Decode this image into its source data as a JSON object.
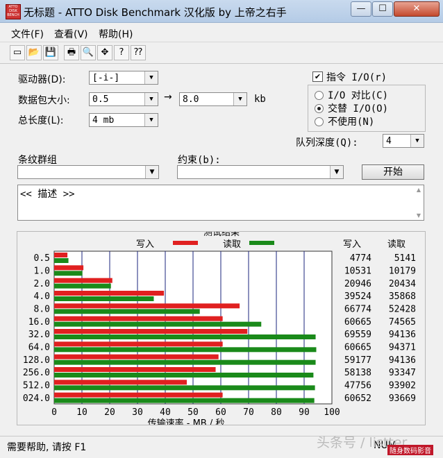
{
  "window": {
    "title": "无标题 - ATTO Disk Benchmark  汉化版 by 上帝之右手",
    "icon_text": "ATTO DISK BENCH",
    "min_glyph": "—",
    "max_glyph": "☐",
    "close_glyph": "✕"
  },
  "menu": [
    "文件(F)",
    "查看(V)",
    "帮助(H)"
  ],
  "toolbar_icons": [
    {
      "name": "new-icon",
      "glyph": "▭"
    },
    {
      "name": "open-icon",
      "glyph": "📂"
    },
    {
      "name": "save-icon",
      "glyph": "💾"
    },
    {
      "name": "print-icon",
      "glyph": "🖶"
    },
    {
      "name": "print-preview-icon",
      "glyph": "🔍"
    },
    {
      "name": "move-icon",
      "glyph": "✥"
    },
    {
      "name": "help-icon",
      "glyph": "?"
    },
    {
      "name": "context-help-icon",
      "glyph": "⁇"
    }
  ],
  "settings": {
    "drive_label": "驱动器(D):",
    "drive_value": "[-i-]",
    "transfer_label": "数据包大小:",
    "transfer_from": "0.5",
    "transfer_to": "8.0",
    "transfer_unit": "kb",
    "arrow": "→",
    "length_label": "总长度(L):",
    "length_value": "4 mb",
    "io_label": "指令 I/O(r)",
    "io_checked": true,
    "mode_options": [
      "I/O 对比(C)",
      "交替 I/O(O)",
      "不使用(N)"
    ],
    "mode_selected": 1,
    "queue_label": "队列深度(Q):",
    "queue_value": "4",
    "stripe_label": "条纹群组",
    "stripe_value": "",
    "constraint_label": "约束(b):",
    "constraint_value": "",
    "start_label": "开始",
    "description": "<< 描述 >>"
  },
  "results": {
    "group_title": "测试结果",
    "legend_write": "写入",
    "legend_read": "读取",
    "col_write": "写入",
    "col_read": "读取",
    "sizes": [
      "0.5",
      "1.0",
      "2.0",
      "4.0",
      "8.0",
      "16.0",
      "32.0",
      "64.0",
      "128.0",
      "256.0",
      "512.0",
      "024.0"
    ],
    "write_values": [
      "4774",
      "10531",
      "20946",
      "39524",
      "66774",
      "60665",
      "69559",
      "60665",
      "59177",
      "58138",
      "47756",
      "60652"
    ],
    "read_values": [
      "5141",
      "10179",
      "20434",
      "35868",
      "52428",
      "74565",
      "94136",
      "94371",
      "94136",
      "93347",
      "93902",
      "93669"
    ],
    "colors": {
      "write": "#e02020",
      "read": "#1a8a1a",
      "grid": "#1a237e"
    }
  },
  "chart_data": {
    "type": "bar",
    "categories": [
      "0.5",
      "1.0",
      "2.0",
      "4.0",
      "8.0",
      "16.0",
      "32.0",
      "64.0",
      "128.0",
      "256.0",
      "512.0",
      "024.0"
    ],
    "series": [
      {
        "name": "写入",
        "values": [
          4.774,
          10.531,
          20.946,
          39.524,
          66.774,
          60.665,
          69.559,
          60.665,
          59.177,
          58.138,
          47.756,
          60.652
        ]
      },
      {
        "name": "读取",
        "values": [
          5.141,
          10.179,
          20.434,
          35.868,
          52.428,
          74.565,
          94.136,
          94.371,
          94.136,
          93.347,
          93.902,
          93.669
        ]
      }
    ],
    "title": "测试结果",
    "xlabel": "传输速率 - MB / 秒",
    "ylabel": "",
    "xlim": [
      0,
      100
    ],
    "xticks": [
      "0",
      "10",
      "20",
      "30",
      "40",
      "50",
      "60",
      "70",
      "80",
      "90",
      "100"
    ],
    "orientation": "horizontal",
    "legend_position": "top",
    "grid": true
  },
  "status": {
    "help_text": "需要帮助, 请按 F1",
    "num_indicator": "NUM"
  },
  "watermark": {
    "text": "头条号 / listter",
    "sub_text": "随身数码影音"
  }
}
